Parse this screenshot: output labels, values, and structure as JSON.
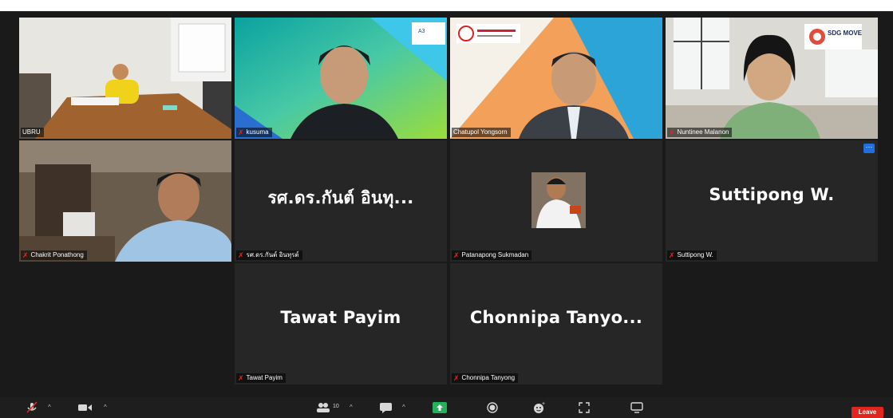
{
  "participants": [
    {
      "name": "UBRU",
      "muted": false
    },
    {
      "name": "kusuma",
      "muted": true
    },
    {
      "name": "Chatupol Yongsorn",
      "muted": false
    },
    {
      "name": "Nuntinee Malanon",
      "muted": true
    },
    {
      "name": "Chakrit Ponathong",
      "muted": true
    },
    {
      "name": "รศ.ดร.กันต์ อินทุรต์",
      "display_name": "รศ.ดร.กันต์ อินทุ...",
      "muted": true
    },
    {
      "name": "Patanapong Sukmadan",
      "muted": true
    },
    {
      "name": "Suttipong W.",
      "display_name": "Suttipong W.",
      "muted": true
    },
    {
      "name": "Tawat Payim",
      "display_name": "Tawat Payim",
      "muted": true
    },
    {
      "name": "Chonnipa Tanyong",
      "display_name": "Chonnipa  Tanyo...",
      "muted": true
    }
  ],
  "logos": {
    "sdg": "SDG MOVE"
  },
  "toolbar": {
    "participant_count": "10",
    "leave_label": "Leave"
  },
  "icons": {
    "muted_mic": "mic-muted-icon",
    "video": "video-icon",
    "participants": "participants-icon",
    "chat": "chat-icon",
    "share": "share-screen-icon",
    "record": "record-icon",
    "reactions": "reactions-icon",
    "apps": "apps-icon",
    "whiteboard": "whiteboard-icon"
  },
  "colors": {
    "active_speaker_border": "#e8dd5a",
    "muted_red": "#e02828",
    "leave_red": "#e0261f",
    "share_green": "#23b25a"
  }
}
